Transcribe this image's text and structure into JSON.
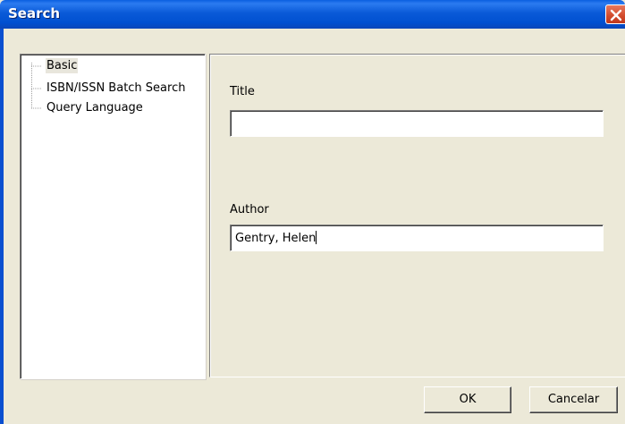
{
  "window": {
    "title": "Search"
  },
  "tree": {
    "items": [
      {
        "label": "Basic",
        "selected": true
      },
      {
        "label": "ISBN/ISSN Batch Search",
        "selected": false
      },
      {
        "label": "Query Language",
        "selected": false
      }
    ]
  },
  "form": {
    "title_label": "Title",
    "title_value": "",
    "author_label": "Author",
    "author_value": "Gentry, Helen"
  },
  "buttons": {
    "ok_label": "OK",
    "cancel_label": "Cancelar"
  },
  "colors": {
    "titlebar": "#0a5ad8",
    "dialog_bg": "#ece9d8",
    "close_button": "#d14a2b"
  },
  "icons": {
    "close": "close-icon"
  }
}
